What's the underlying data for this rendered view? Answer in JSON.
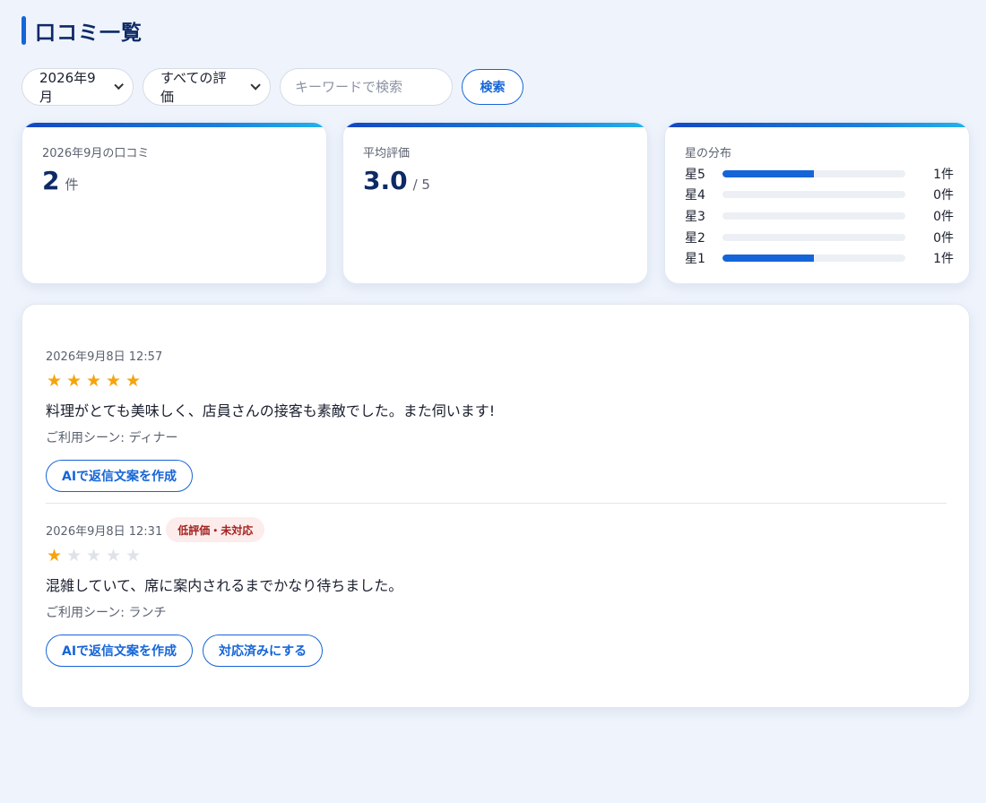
{
  "header": {
    "title": "口コミ一覧"
  },
  "filters": {
    "month_value": "2026年9月",
    "rating_value": "すべての評価",
    "search_placeholder": "キーワードで検索",
    "search_button_label": "検索"
  },
  "stats": {
    "count_card": {
      "label": "2026年9月の口コミ",
      "value": "2",
      "unit": "件"
    },
    "average_card": {
      "label": "平均評価",
      "value": "3.0",
      "unit": "/ 5"
    },
    "distribution_card": {
      "label": "星の分布",
      "rows": [
        {
          "label": "星5",
          "count_text": "1件",
          "fraction": 0.5
        },
        {
          "label": "星4",
          "count_text": "0件",
          "fraction": 0
        },
        {
          "label": "星3",
          "count_text": "0件",
          "fraction": 0
        },
        {
          "label": "星2",
          "count_text": "0件",
          "fraction": 0
        },
        {
          "label": "星1",
          "count_text": "1件",
          "fraction": 0.5
        }
      ]
    }
  },
  "reviews": [
    {
      "date": "2026年9月8日 12:57",
      "badge": "",
      "rating": 5,
      "text": "料理がとても美味しく、店員さんの接客も素敵でした。また伺います!",
      "scene": "ご利用シーン: ディナー",
      "actions": [
        "AIで返信文案を作成"
      ]
    },
    {
      "date": "2026年9月8日 12:31",
      "badge": "低評価・未対応",
      "rating": 1,
      "text": "混雑していて、席に案内されるまでかなり待ちました。",
      "scene": "ご利用シーン: ランチ",
      "actions": [
        "AIで返信文案を作成",
        "対応済みにする"
      ]
    }
  ],
  "colors": {
    "accent": "#1565d8",
    "title": "#0d2a66",
    "star_on": "#f5a40c",
    "star_off": "#dfe2e8",
    "badge_bg": "#fdecec",
    "badge_text": "#a3231f",
    "page_bg": "#eff4fc"
  }
}
